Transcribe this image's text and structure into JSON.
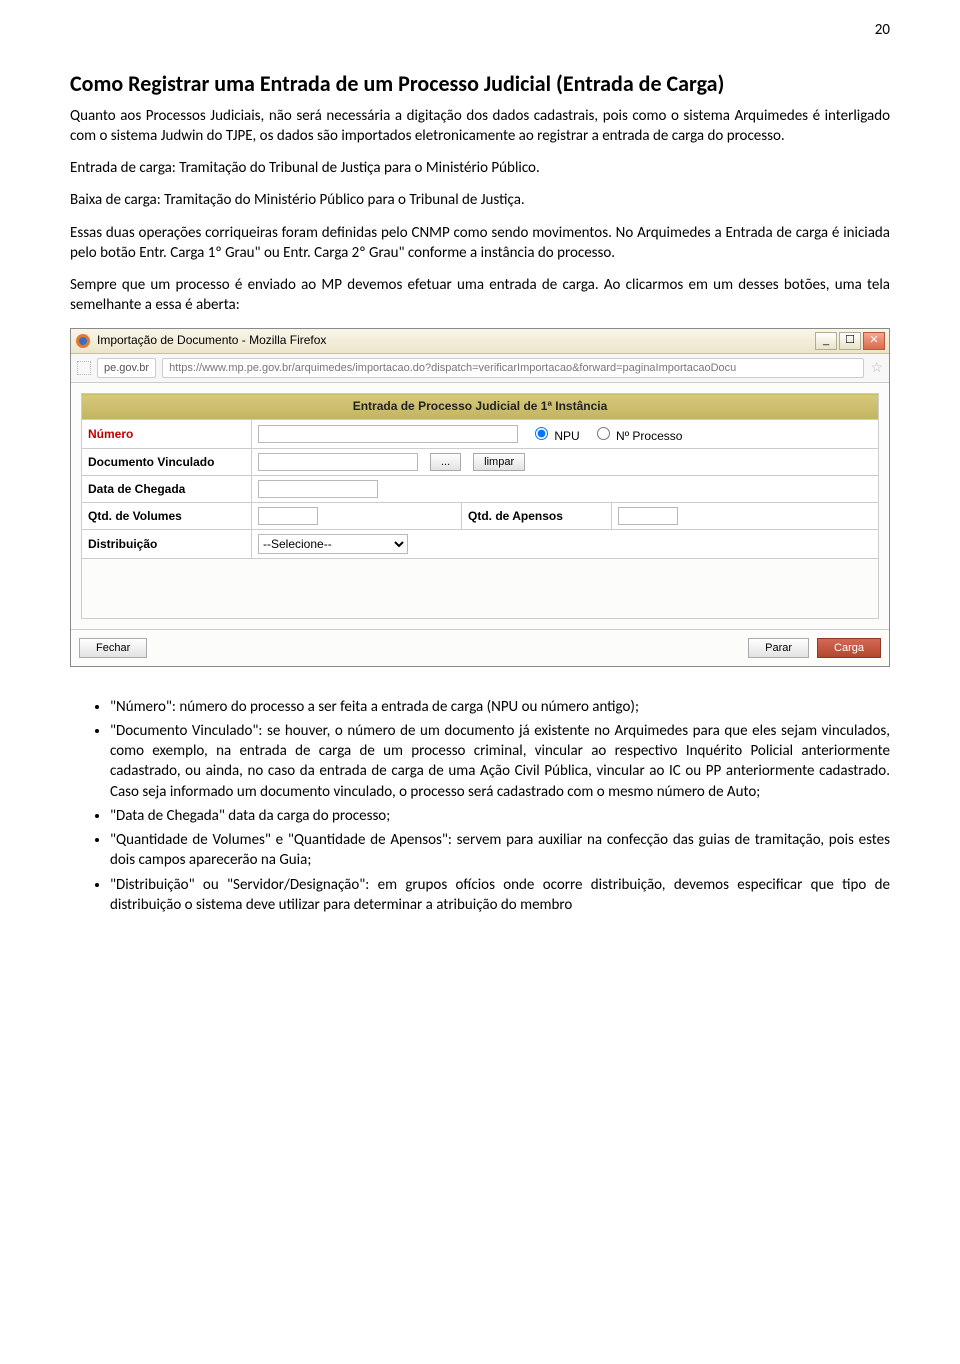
{
  "page_number": "20",
  "title": "Como Registrar uma Entrada de um Processo Judicial (Entrada de Carga)",
  "p1": "Quanto aos Processos Judiciais, não será necessária a digitação dos dados cadastrais, pois como o sistema Arquimedes é interligado com o sistema Judwin do TJPE, os dados são importados eletronicamente ao registrar a entrada de carga do processo.",
  "p2": "Entrada de carga: Tramitação do Tribunal de Justiça para o Ministério Público.",
  "p3": "Baixa de carga: Tramitação do Ministério Público para o Tribunal de Justiça.",
  "p4": "Essas duas operações corriqueiras foram definidas pelo CNMP como sendo movimentos. No Arquimedes a Entrada de carga é iniciada pelo botão Entr. Carga 1º Grau\" ou Entr. Carga 2º Grau\" conforme a instância do processo.",
  "p5": "Sempre que um processo é enviado ao MP devemos efetuar uma entrada de carga. Ao clicarmos em um desses botões, uma tela semelhante a essa é aberta:",
  "window": {
    "title": "Importação de Documento - Mozilla Firefox",
    "site": "pe.gov.br",
    "url": "https://www.mp.pe.gov.br/arquimedes/importacao.do?dispatch=verificarImportacao&forward=paginaImportacaoDocu",
    "form_title": "Entrada de Processo Judicial de 1ª Instância",
    "numero_label": "Número",
    "radio_npu": "NPU",
    "radio_nproc": "Nº Processo",
    "doc_vinc_label": "Documento Vinculado",
    "btn_browse": "...",
    "btn_limpar": "limpar",
    "data_chegada_label": "Data de Chegada",
    "qtd_vol_label": "Qtd. de Volumes",
    "qtd_apensos_label": "Qtd. de Apensos",
    "distrib_label": "Distribuição",
    "distrib_value": "--Selecione--",
    "btn_fechar": "Fechar",
    "btn_parar": "Parar",
    "btn_carga": "Carga"
  },
  "bullets": {
    "b1": "\"Número\": número do processo a ser feita a entrada de carga (NPU ou número antigo);",
    "b2": "\"Documento Vinculado\": se houver, o número de um documento já existente no Arquimedes para que eles sejam vinculados, como exemplo, na entrada de carga de um processo criminal, vincular ao respectivo Inquérito Policial anteriormente cadastrado, ou ainda, no caso da entrada de carga de uma Ação Civil Pública, vincular ao IC ou PP anteriormente cadastrado. Caso seja informado um documento vinculado, o processo será cadastrado com o mesmo número de Auto;",
    "b3": "\"Data de Chegada\" data da carga do processo;",
    "b4": "\"Quantidade de Volumes\" e \"Quantidade de Apensos\": servem para auxiliar na confecção das guias de tramitação, pois estes dois campos aparecerão na Guia;",
    "b5": " \"Distribuição\" ou \"Servidor/Designação\": em grupos ofícios onde ocorre distribuição, devemos especificar que tipo de distribuição o sistema deve utilizar para determinar a atribuição do membro"
  }
}
